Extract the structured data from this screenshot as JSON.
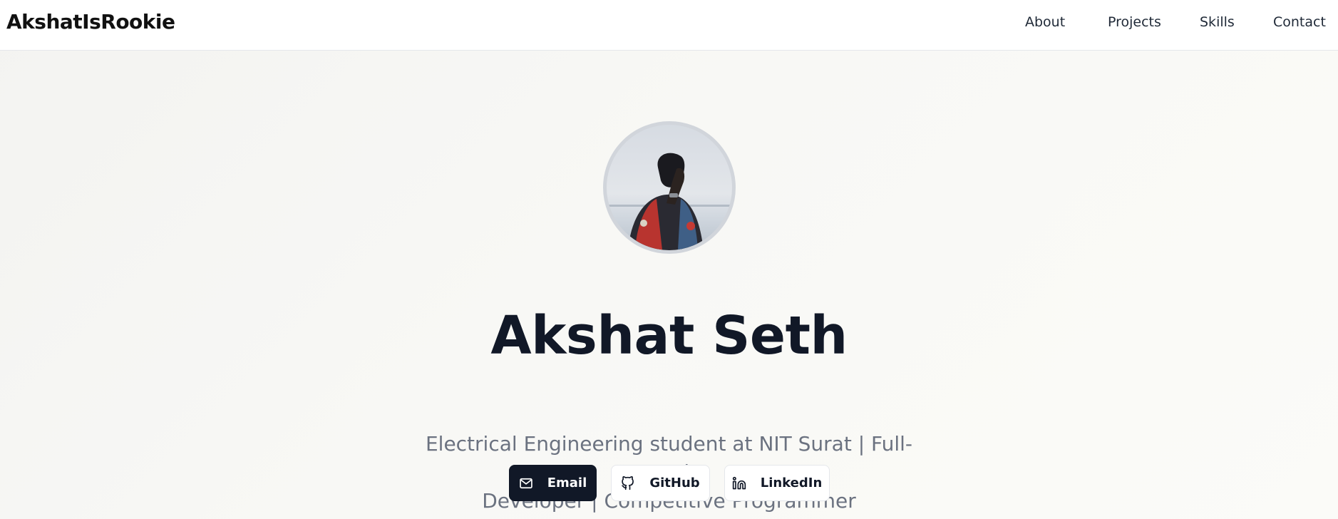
{
  "header": {
    "brand": "AkshatIsRookie",
    "nav": [
      {
        "label": "About"
      },
      {
        "label": "Projects"
      },
      {
        "label": "Skills"
      },
      {
        "label": "Contact"
      }
    ]
  },
  "hero": {
    "name": "Akshat Seth",
    "tagline_line1": "Electrical Engineering student at NIT Surat | Full-stack",
    "tagline_line2": "Developer | Competitive Programmer",
    "buttons": [
      {
        "label": "Email",
        "icon": "mail-icon"
      },
      {
        "label": "GitHub",
        "icon": "github-icon"
      },
      {
        "label": "LinkedIn",
        "icon": "linkedin-icon"
      }
    ]
  },
  "colors": {
    "primary_dark": "#111827",
    "muted_text": "#6b7280",
    "background": "#f8f8f5"
  }
}
